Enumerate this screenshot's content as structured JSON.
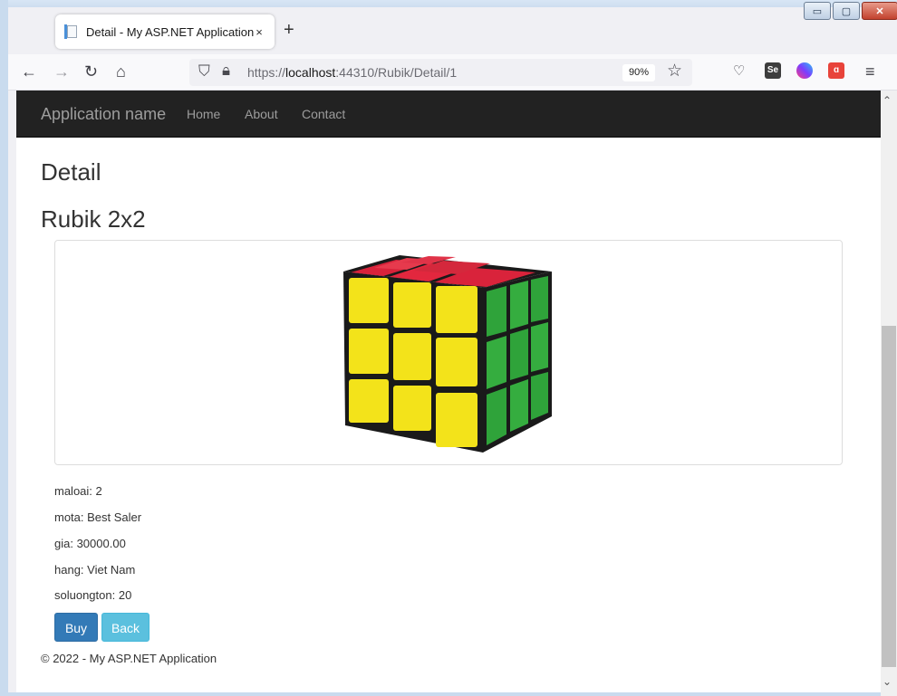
{
  "browser": {
    "tab_title": "Detail - My ASP.NET Application",
    "tab_close": "×",
    "new_tab": "+",
    "url_prefix": "https://",
    "url_host": "localhost",
    "url_rest": ":44310/Rubik/Detail/1",
    "zoom": "90%",
    "window_buttons": {
      "minimize": "▭",
      "maximize": "▢",
      "close": "✕"
    }
  },
  "navbar": {
    "brand": "Application name",
    "links": [
      "Home",
      "About",
      "Contact"
    ]
  },
  "page": {
    "title": "Detail",
    "product_name": "Rubik 2x2",
    "image_icon": "rubiks-cube-image"
  },
  "fields": [
    {
      "label": "maloai",
      "value": "2"
    },
    {
      "label": "mota",
      "value": "Best Saler"
    },
    {
      "label": "gia",
      "value": "30000.00"
    },
    {
      "label": "hang",
      "value": "Viet Nam"
    },
    {
      "label": "soluongton",
      "value": "20"
    }
  ],
  "field_text": [
    "maloai: 2",
    "mota: Best Saler",
    "gia: 30000.00",
    "hang: Viet Nam",
    "soluongton: 20"
  ],
  "buttons": {
    "buy": "Buy",
    "back": "Back"
  },
  "footer": "© 2022 - My ASP.NET Application",
  "colors": {
    "navbar_bg": "#222222",
    "btn_primary": "#337ab7",
    "btn_info": "#5bc0de"
  }
}
